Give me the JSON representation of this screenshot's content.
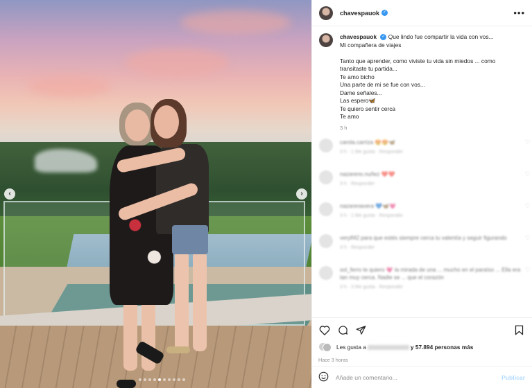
{
  "post": {
    "username": "chavespauok",
    "more_label": "•••"
  },
  "caption": {
    "username": "chavespauok",
    "lines": [
      "Que lindo fue compartir la vida con vos...",
      "Mi compañera de viajes",
      "",
      "Tanto que aprender, como viviste tu vida sin miedos ... como",
      "transitaste tu partida...",
      "Te amo bicho",
      "Una parte de mi se fue con vos...",
      "Dame señales...",
      "Las espero🦋",
      "Te quiero sentir cerca",
      "Te amo"
    ],
    "time": "3 h"
  },
  "comments": [
    {
      "user": "carola.carriza",
      "text": "😍😍🦋",
      "meta": "3 h · 1 Me gusta · Responder"
    },
    {
      "user": "nazareno.nuñez",
      "text": "❤️❤️",
      "meta": "3 h · Responder"
    },
    {
      "user": "nazarenavera",
      "text": "💙🦋💗",
      "meta": "3 h · 1 Me gusta · Responder"
    },
    {
      "user": "verylf42",
      "text": "para que estés siempre cerca tu valentía y seguir figurando",
      "meta": "3 h · Responder"
    },
    {
      "user": "sol_ferro",
      "text": "te quiero 💗 la mirada de una ... mucho en el paraíso ... Ella era tan muy cerca. Nadie se ... que el corazón",
      "meta": "3 h · 3 Me gusta · Responder"
    }
  ],
  "likes": {
    "prefix": "Les gusta a",
    "suffix": "y 57.894 personas más"
  },
  "posted": "Hace 3 horas",
  "comment_box": {
    "placeholder": "Añade un comentario...",
    "post_label": "Publicar"
  },
  "carousel": {
    "prev": "‹",
    "next": "›",
    "dots": 10,
    "active_dot": 4
  },
  "icons": [
    "verified-icon",
    "more-icon",
    "arrow-left-icon",
    "arrow-right-icon",
    "heart-icon",
    "comment-icon",
    "share-icon",
    "bookmark-icon",
    "emoji-icon"
  ],
  "colors": {
    "verified": "#3897f0",
    "post_button": "#b3dbff",
    "muted": "#8e8e8e"
  }
}
